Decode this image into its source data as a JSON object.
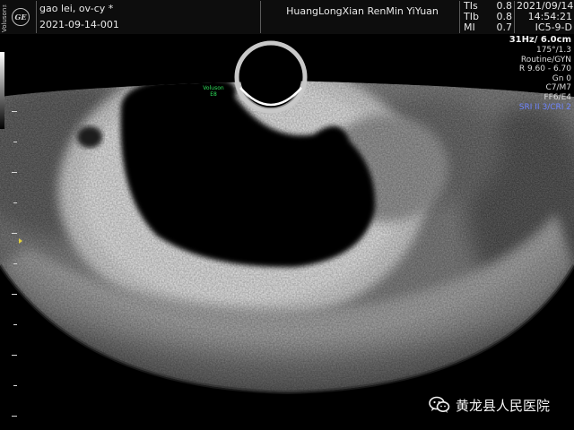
{
  "header": {
    "brand_vertical": "Voluson™ E8",
    "logo_text": "GE",
    "patient_line": "gao lei, ov-cy  *",
    "exam_id": "2021-09-14-001",
    "hospital": "HuangLongXian RenMin YiYuan",
    "indices": [
      {
        "label": "TIs",
        "value": "0.8"
      },
      {
        "label": "TIb",
        "value": "0.8"
      },
      {
        "label": "MI",
        "value": "0.7"
      }
    ],
    "date": "2021/09/14",
    "time": "14:54:21",
    "probe": "IC5-9-D"
  },
  "parameters": {
    "frame_depth": "31Hz/ 6.0cm",
    "angle": "175°/1.3",
    "preset": "Routine/GYN",
    "range": "R 9.60 - 6.70",
    "gain": "Gn  0",
    "curves": "C7/M7",
    "filters": "FF6/E4",
    "sri": "SRI II 3/CRI 2"
  },
  "image": {
    "probe_mark_line1": "Voluson",
    "probe_mark_line2": "E8",
    "focus_marker_color": "#e0d040",
    "sri_color": "#6f86ff",
    "probe_mark_color": "#2ee05a"
  },
  "watermark": {
    "icon": "wechat-icon",
    "text": "黄龙县人民医院"
  }
}
